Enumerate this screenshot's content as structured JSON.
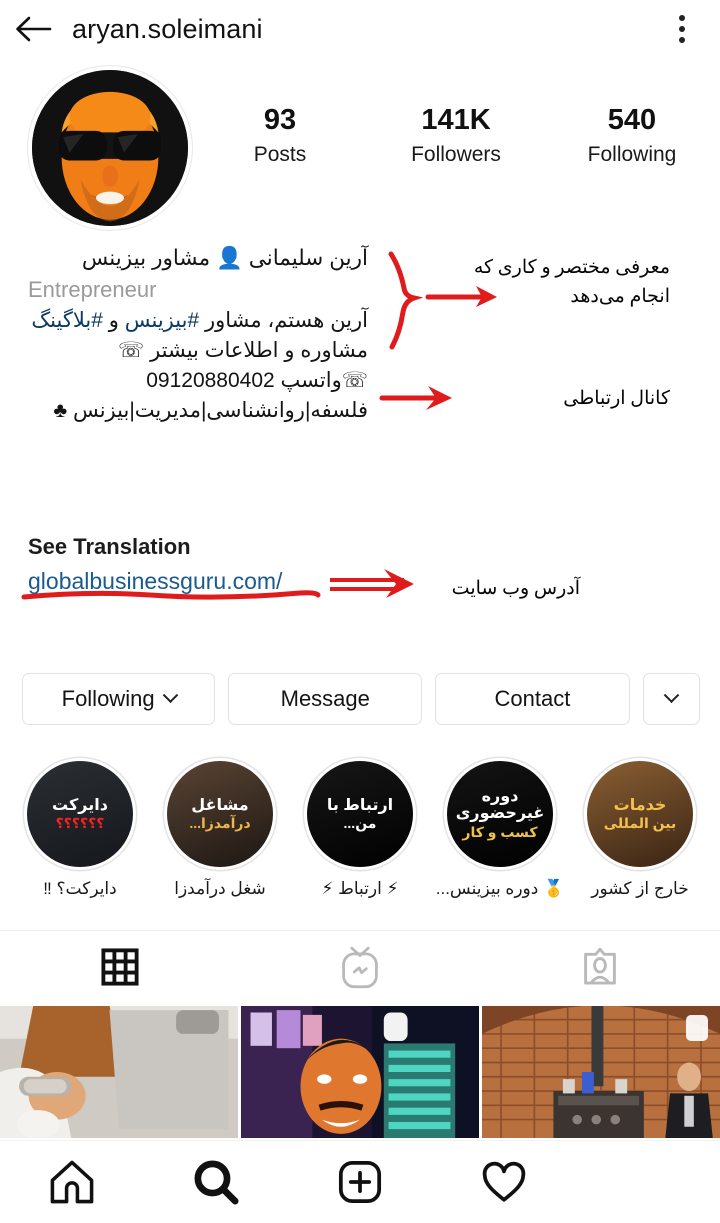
{
  "header": {
    "username": "aryan.soleimani",
    "back_icon": "back-arrow-icon",
    "menu_icon": "overflow-menu-icon"
  },
  "profile": {
    "avatar_alt": "profile-picture",
    "stats": [
      {
        "value": "93",
        "label": "Posts"
      },
      {
        "value": "141K",
        "label": "Followers"
      },
      {
        "value": "540",
        "label": "Following"
      }
    ]
  },
  "bio": {
    "line1": "آرین سلیمانی 👤 مشاور بیزینس",
    "line2": "Entrepreneur",
    "line3_a": "آرین هستم، مشاور ",
    "line3_tag1": "#بیزینس",
    "line3_b": " و ",
    "line3_tag2": "#بلاگینگ",
    "line4": "مشاوره و اطلاعات بیشتر ☏",
    "line5": "☏واتسپ 09120880402",
    "line6": "فلسفه|روانشناسی|مدیریت|بیزنس ♣"
  },
  "translation": {
    "label": "See Translation"
  },
  "website": {
    "url": "globalbusinessguru.com/"
  },
  "actions": {
    "following": "Following",
    "message": "Message",
    "contact": "Contact",
    "more_icon": "chevron-down-icon"
  },
  "highlights": [
    {
      "label": "دایرکت؟ ‼",
      "cover_line1": "دایرکت",
      "cover_line2": "؟؟؟؟؟؟",
      "c1": "#ffffff",
      "c2": "#ff2020",
      "bg1": "#2b2f33",
      "bg2": "#14181c"
    },
    {
      "label": "شغل درآمدزا",
      "cover_line1": "مشاغل",
      "cover_line2": "درآمدزا...",
      "c1": "#ffffff",
      "c2": "#f0b64a",
      "bg1": "#5a4434",
      "bg2": "#1d1713"
    },
    {
      "label": "⚡ ارتباط ⚡",
      "cover_line1": "ارتباط با",
      "cover_line2": "من...",
      "c1": "#ffffff",
      "c2": "#ffffff",
      "bg1": "#171717",
      "bg2": "#000000"
    },
    {
      "label": "🥇 دوره بیزینس...",
      "cover_line1": "دوره غیرحضوری",
      "cover_line2": "کسب و کار",
      "c1": "#ffffff",
      "c2": "#f2c14a",
      "bg1": "#141414",
      "bg2": "#000000"
    },
    {
      "label": "خارج از کشور",
      "cover_line1": "خدمات",
      "cover_line2": "بین المللی",
      "c1": "#f3c24c",
      "c2": "#f3c24c",
      "bg1": "#8a5f33",
      "bg2": "#3a2414"
    }
  ],
  "tabs": [
    {
      "icon": "grid-icon",
      "active": true
    },
    {
      "icon": "igtv-icon",
      "active": false
    },
    {
      "icon": "tagged-icon",
      "active": false
    }
  ],
  "grid_cells": [
    {
      "name": "post-thumbnail-1",
      "has_badge": false
    },
    {
      "name": "post-thumbnail-2",
      "has_badge": true
    },
    {
      "name": "post-thumbnail-3",
      "has_badge": false
    }
  ],
  "bottom_nav": [
    {
      "icon": "home-icon"
    },
    {
      "icon": "search-icon"
    },
    {
      "icon": "add-post-icon"
    },
    {
      "icon": "activity-heart-icon"
    }
  ],
  "annotations": [
    {
      "name": "annotation-bio",
      "line1": "معرفی مختصر و کاری که",
      "line2": "انجام می‌دهد"
    },
    {
      "name": "annotation-contact",
      "line1": "کانال ارتباطی",
      "line2": ""
    },
    {
      "name": "annotation-website",
      "line1": "آدرس وب سایت",
      "line2": ""
    }
  ],
  "colors": {
    "annotation_red": "#e01b1b",
    "link_blue": "#1a5a8e",
    "hashtag_blue": "#0b3a63",
    "muted_gray": "#9a9a9a"
  }
}
